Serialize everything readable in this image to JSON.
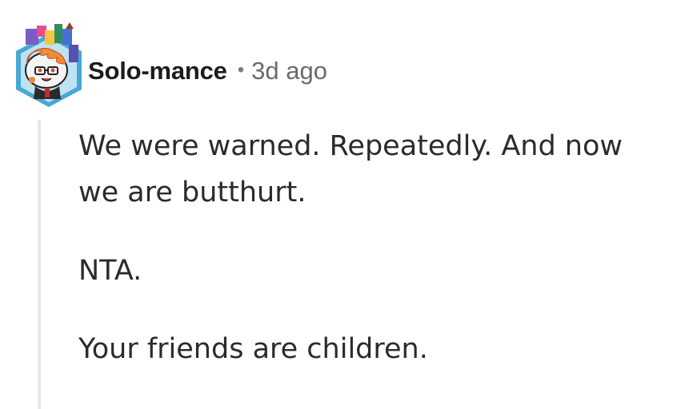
{
  "comment": {
    "author": "Solo-mance",
    "separator": "•",
    "timestamp": "3d ago",
    "paragraphs": [
      "We were warned. Repeatedly. And now we are butthurt.",
      "NTA.",
      "Your friends are children."
    ]
  },
  "colors": {
    "username": "#1c1c1c",
    "timestamp": "#6a6a6a",
    "thread_line": "#e6e6e6",
    "avatar_frame": "#47a8d4"
  },
  "icons": {
    "avatar": "snoo-avatar-icon"
  }
}
